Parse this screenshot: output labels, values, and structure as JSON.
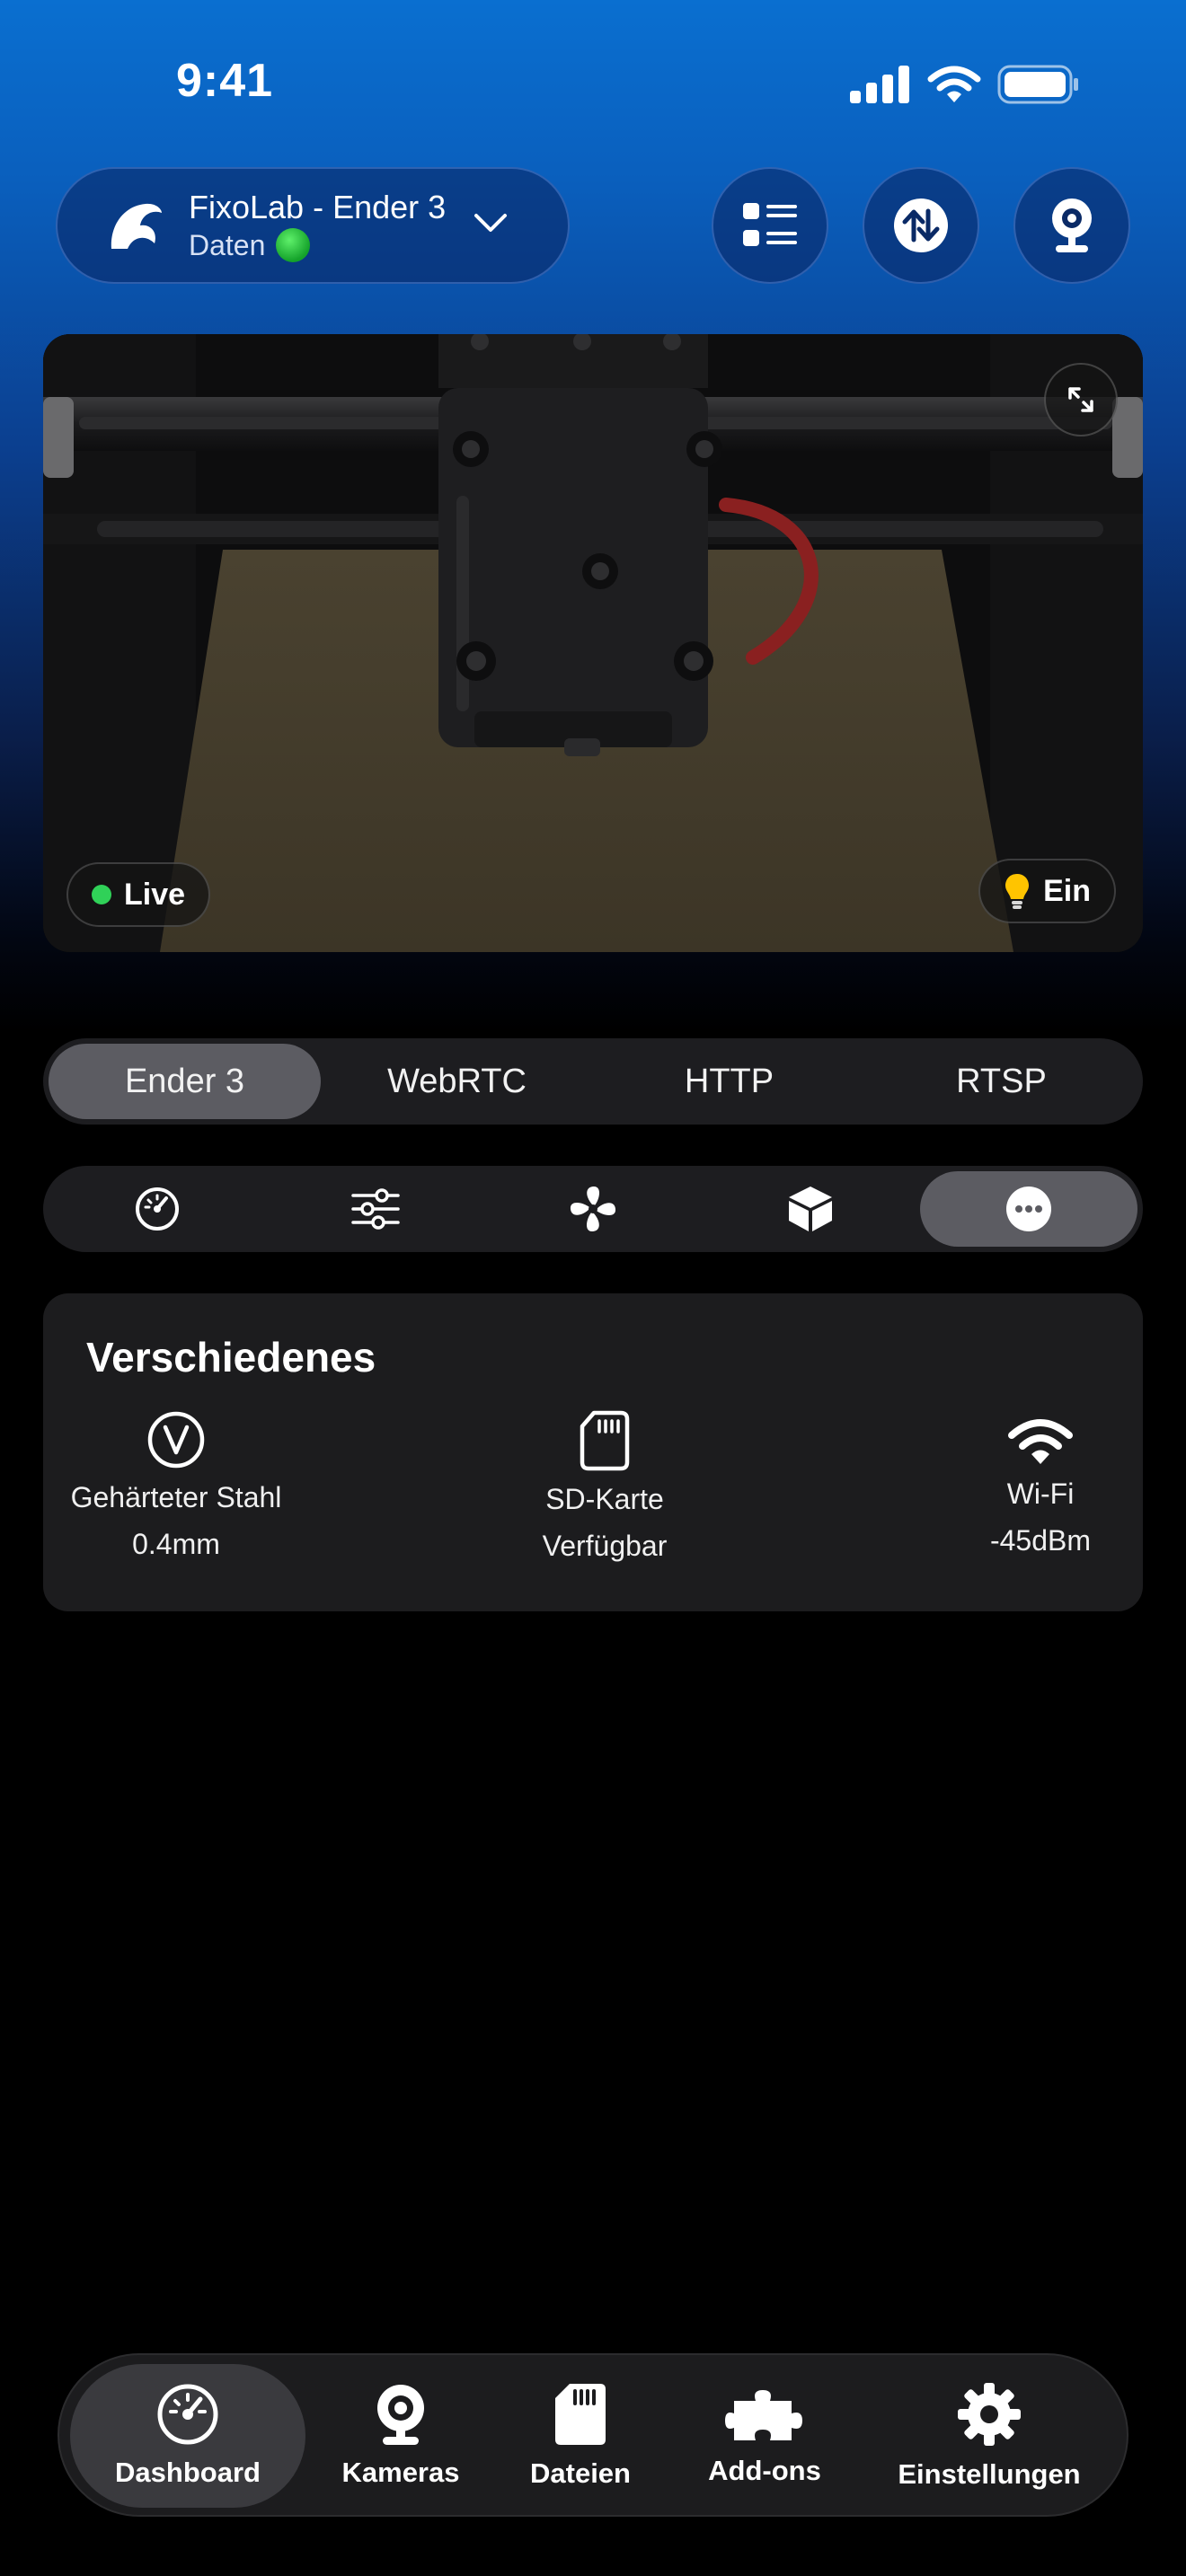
{
  "status_bar": {
    "time": "9:41"
  },
  "header": {
    "printer_name": "FixoLab - Ender 3",
    "printer_status": "Daten"
  },
  "camera": {
    "live_label": "Live",
    "light_label": "Ein",
    "colors": {
      "live_dot": "#30d158",
      "bulb": "#ffc400"
    }
  },
  "stream_tabs": [
    "Ender 3",
    "WebRTC",
    "HTTP",
    "RTSP"
  ],
  "stream_tabs_selected": "Ender 3",
  "section_tabs": [
    "gauge-icon",
    "sliders-icon",
    "fan-icon",
    "cube-icon",
    "more-icon"
  ],
  "section_tabs_selected": "more-icon",
  "misc": {
    "title": "Verschiedenes",
    "nozzle": {
      "line1": "Gehärteter Stahl",
      "line2": "0.4mm"
    },
    "sd": {
      "line1": "SD-Karte",
      "line2": "Verfügbar"
    },
    "wifi": {
      "line1": "Wi-Fi",
      "line2": "-45dBm"
    }
  },
  "bottom_nav": {
    "items": [
      {
        "label": "Dashboard",
        "icon": "gauge-icon"
      },
      {
        "label": "Kameras",
        "icon": "webcam-icon"
      },
      {
        "label": "Dateien",
        "icon": "sd-card-icon"
      },
      {
        "label": "Add-ons",
        "icon": "puzzle-icon"
      },
      {
        "label": "Einstellungen",
        "icon": "gear-icon"
      }
    ],
    "selected": "Dashboard"
  }
}
